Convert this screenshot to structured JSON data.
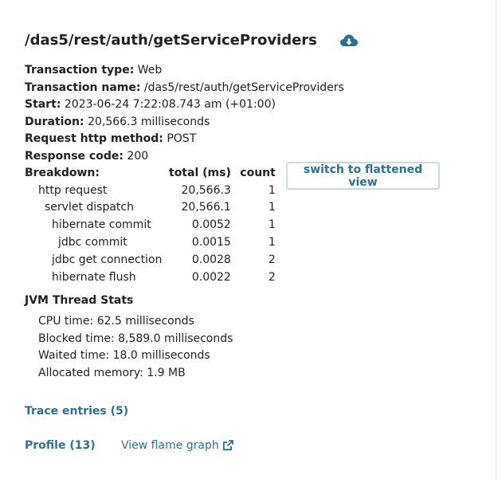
{
  "title": "/das5/rest/auth/getServiceProviders",
  "properties": [
    {
      "label": "Transaction type:",
      "value": "Web"
    },
    {
      "label": "Transaction name:",
      "value": "/das5/rest/auth/getServiceProviders"
    },
    {
      "label": "Start:",
      "value": "2023-06-24 7:22:08.743 am (+01:00)"
    },
    {
      "label": "Duration:",
      "value": "20,566.3 milliseconds"
    },
    {
      "label": "Request http method:",
      "value": "POST"
    },
    {
      "label": "Response code:",
      "value": "200"
    }
  ],
  "breakdown": {
    "header": {
      "name": "Breakdown:",
      "total": "total (ms)",
      "count": "count"
    },
    "rows": [
      {
        "name": "http request",
        "indent": 1,
        "total": "20,566.3",
        "count": "1"
      },
      {
        "name": "servlet dispatch",
        "indent": 2,
        "total": "20,566.1",
        "count": "1"
      },
      {
        "name": "hibernate commit",
        "indent": 3,
        "total": "0.0052",
        "count": "1"
      },
      {
        "name": "jdbc commit",
        "indent": 4,
        "total": "0.0015",
        "count": "1"
      },
      {
        "name": "jdbc get connection",
        "indent": 3,
        "total": "0.0028",
        "count": "2"
      },
      {
        "name": "hibernate flush",
        "indent": 3,
        "total": "0.0022",
        "count": "2"
      }
    ]
  },
  "switch_label": "switch to flattened view",
  "jvm": {
    "title": "JVM Thread Stats",
    "stats": [
      "CPU time: 62.5 milliseconds",
      "Blocked time: 8,589.0 milliseconds",
      "Waited time: 18.0 milliseconds",
      "Allocated memory: 1.9 MB"
    ]
  },
  "links": {
    "trace_entries": "Trace entries (5)",
    "profile": "Profile (13)",
    "flame_graph": "View flame graph"
  },
  "icons": {
    "download": "cloud-download-icon",
    "external": "external-link-icon"
  },
  "colors": {
    "link": "#31708f",
    "icon": "#2f6e8c",
    "button_border": "#c9d9e5"
  }
}
